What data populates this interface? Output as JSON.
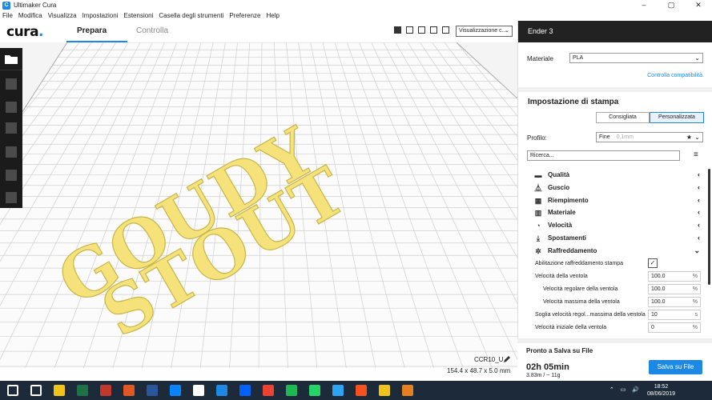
{
  "window": {
    "title": "Ultimaker Cura",
    "controls": [
      "–",
      "▢",
      "✕"
    ]
  },
  "menu": [
    "File",
    "Modifica",
    "Visualizza",
    "Impostazioni",
    "Estensioni",
    "Casella degli strumenti",
    "Preferenze",
    "Help"
  ],
  "header": {
    "logo": "cura",
    "tabs": [
      "Prepara",
      "Controlla"
    ],
    "view_select": "Visualizzazione c..."
  },
  "scene": {
    "object_name": "CCR10_U",
    "object_size": "154.4 x 48.7 x 5.0 mm",
    "words": [
      "GOUDY",
      "STOUT"
    ]
  },
  "printer": {
    "name": "Ender 3"
  },
  "material": {
    "label": "Materiale",
    "value": "PLA",
    "link": "Controlla compatibilità"
  },
  "print_settings": {
    "title": "Impostazione di stampa",
    "modes": [
      "Consigliata",
      "Personalizzata"
    ],
    "profile_label": "Profilo:",
    "profile_value": "Fine",
    "profile_hint": "0.1mm",
    "search_placeholder": "Ricerca...",
    "categories": [
      {
        "name": "Qualità",
        "icon": "quality-icon",
        "glyph": "▬",
        "chev": "‹"
      },
      {
        "name": "Guscio",
        "icon": "shell-icon",
        "glyph": "⏅",
        "chev": "‹"
      },
      {
        "name": "Riempimento",
        "icon": "infill-icon",
        "glyph": "▦",
        "chev": "‹"
      },
      {
        "name": "Materiale",
        "icon": "material-icon",
        "glyph": "▥",
        "chev": "‹"
      },
      {
        "name": "Velocità",
        "icon": "speed-icon",
        "glyph": "◔",
        "chev": "‹"
      },
      {
        "name": "Spostamenti",
        "icon": "travel-icon",
        "glyph": "⤓",
        "chev": "‹"
      },
      {
        "name": "Raffreddamento",
        "icon": "cooling-icon",
        "glyph": "✲",
        "chev": "⌄"
      }
    ],
    "cooling_settings": [
      {
        "name": "Abilitazione raffreddamento stampa",
        "type": "check",
        "value": "✓",
        "indent": 0
      },
      {
        "name": "Velocità della ventola",
        "value": "100.0",
        "unit": "%",
        "indent": 0
      },
      {
        "name": "Velocità regolare della ventola",
        "value": "100.0",
        "unit": "%",
        "indent": 1
      },
      {
        "name": "Velocità massima della ventola",
        "value": "100.0",
        "unit": "%",
        "indent": 1
      },
      {
        "name": "Soglia velocità regol...massima della ventola",
        "value": "10",
        "unit": "s",
        "indent": 0
      },
      {
        "name": "Velocità iniziale della ventola",
        "value": "0",
        "unit": "%",
        "indent": 0
      }
    ]
  },
  "save": {
    "title": "Pronto a Salva su File",
    "time": "02h 05min",
    "stats": "3.83m / ~ 11g",
    "button": "Salva su File"
  },
  "taskbar": {
    "time": "18:52",
    "date": "08/06/2019",
    "colors": [
      "#ffffff",
      "#ffffff",
      "#f0c419",
      "#1e7145",
      "#c0392b",
      "#e25822",
      "#2b579a",
      "#0a84ff",
      "#ffffff",
      "#1e88e5",
      "#0061fe",
      "#ea4335",
      "#1db954",
      "#25d366",
      "#2ea3f2",
      "#f4511e",
      "#f0c419",
      "#e67e22"
    ]
  }
}
